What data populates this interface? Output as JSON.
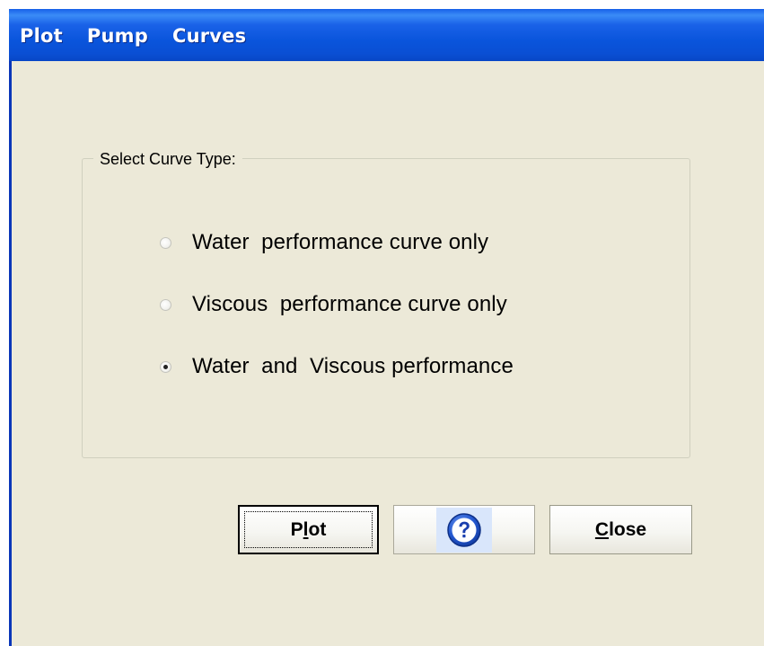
{
  "window": {
    "title": "Plot  Pump  Curves"
  },
  "group": {
    "label": "Select Curve Type:"
  },
  "radio_options": [
    {
      "label": "Water  performance curve only",
      "selected": false
    },
    {
      "label": "Viscous  performance curve only",
      "selected": false
    },
    {
      "label": "Water  and  Viscous performance",
      "selected": true
    }
  ],
  "buttons": {
    "plot": {
      "label": "Plot",
      "mnemonic": "l",
      "before": "P",
      "after": "ot"
    },
    "help": {
      "icon": "help-question-icon"
    },
    "close": {
      "label": "Close",
      "mnemonic": "C",
      "before": "",
      "after": "lose"
    }
  },
  "colors": {
    "title_bar": "#0a55dc",
    "dialog_bg": "#ece9d8",
    "help_icon": "#1a4fc4"
  }
}
